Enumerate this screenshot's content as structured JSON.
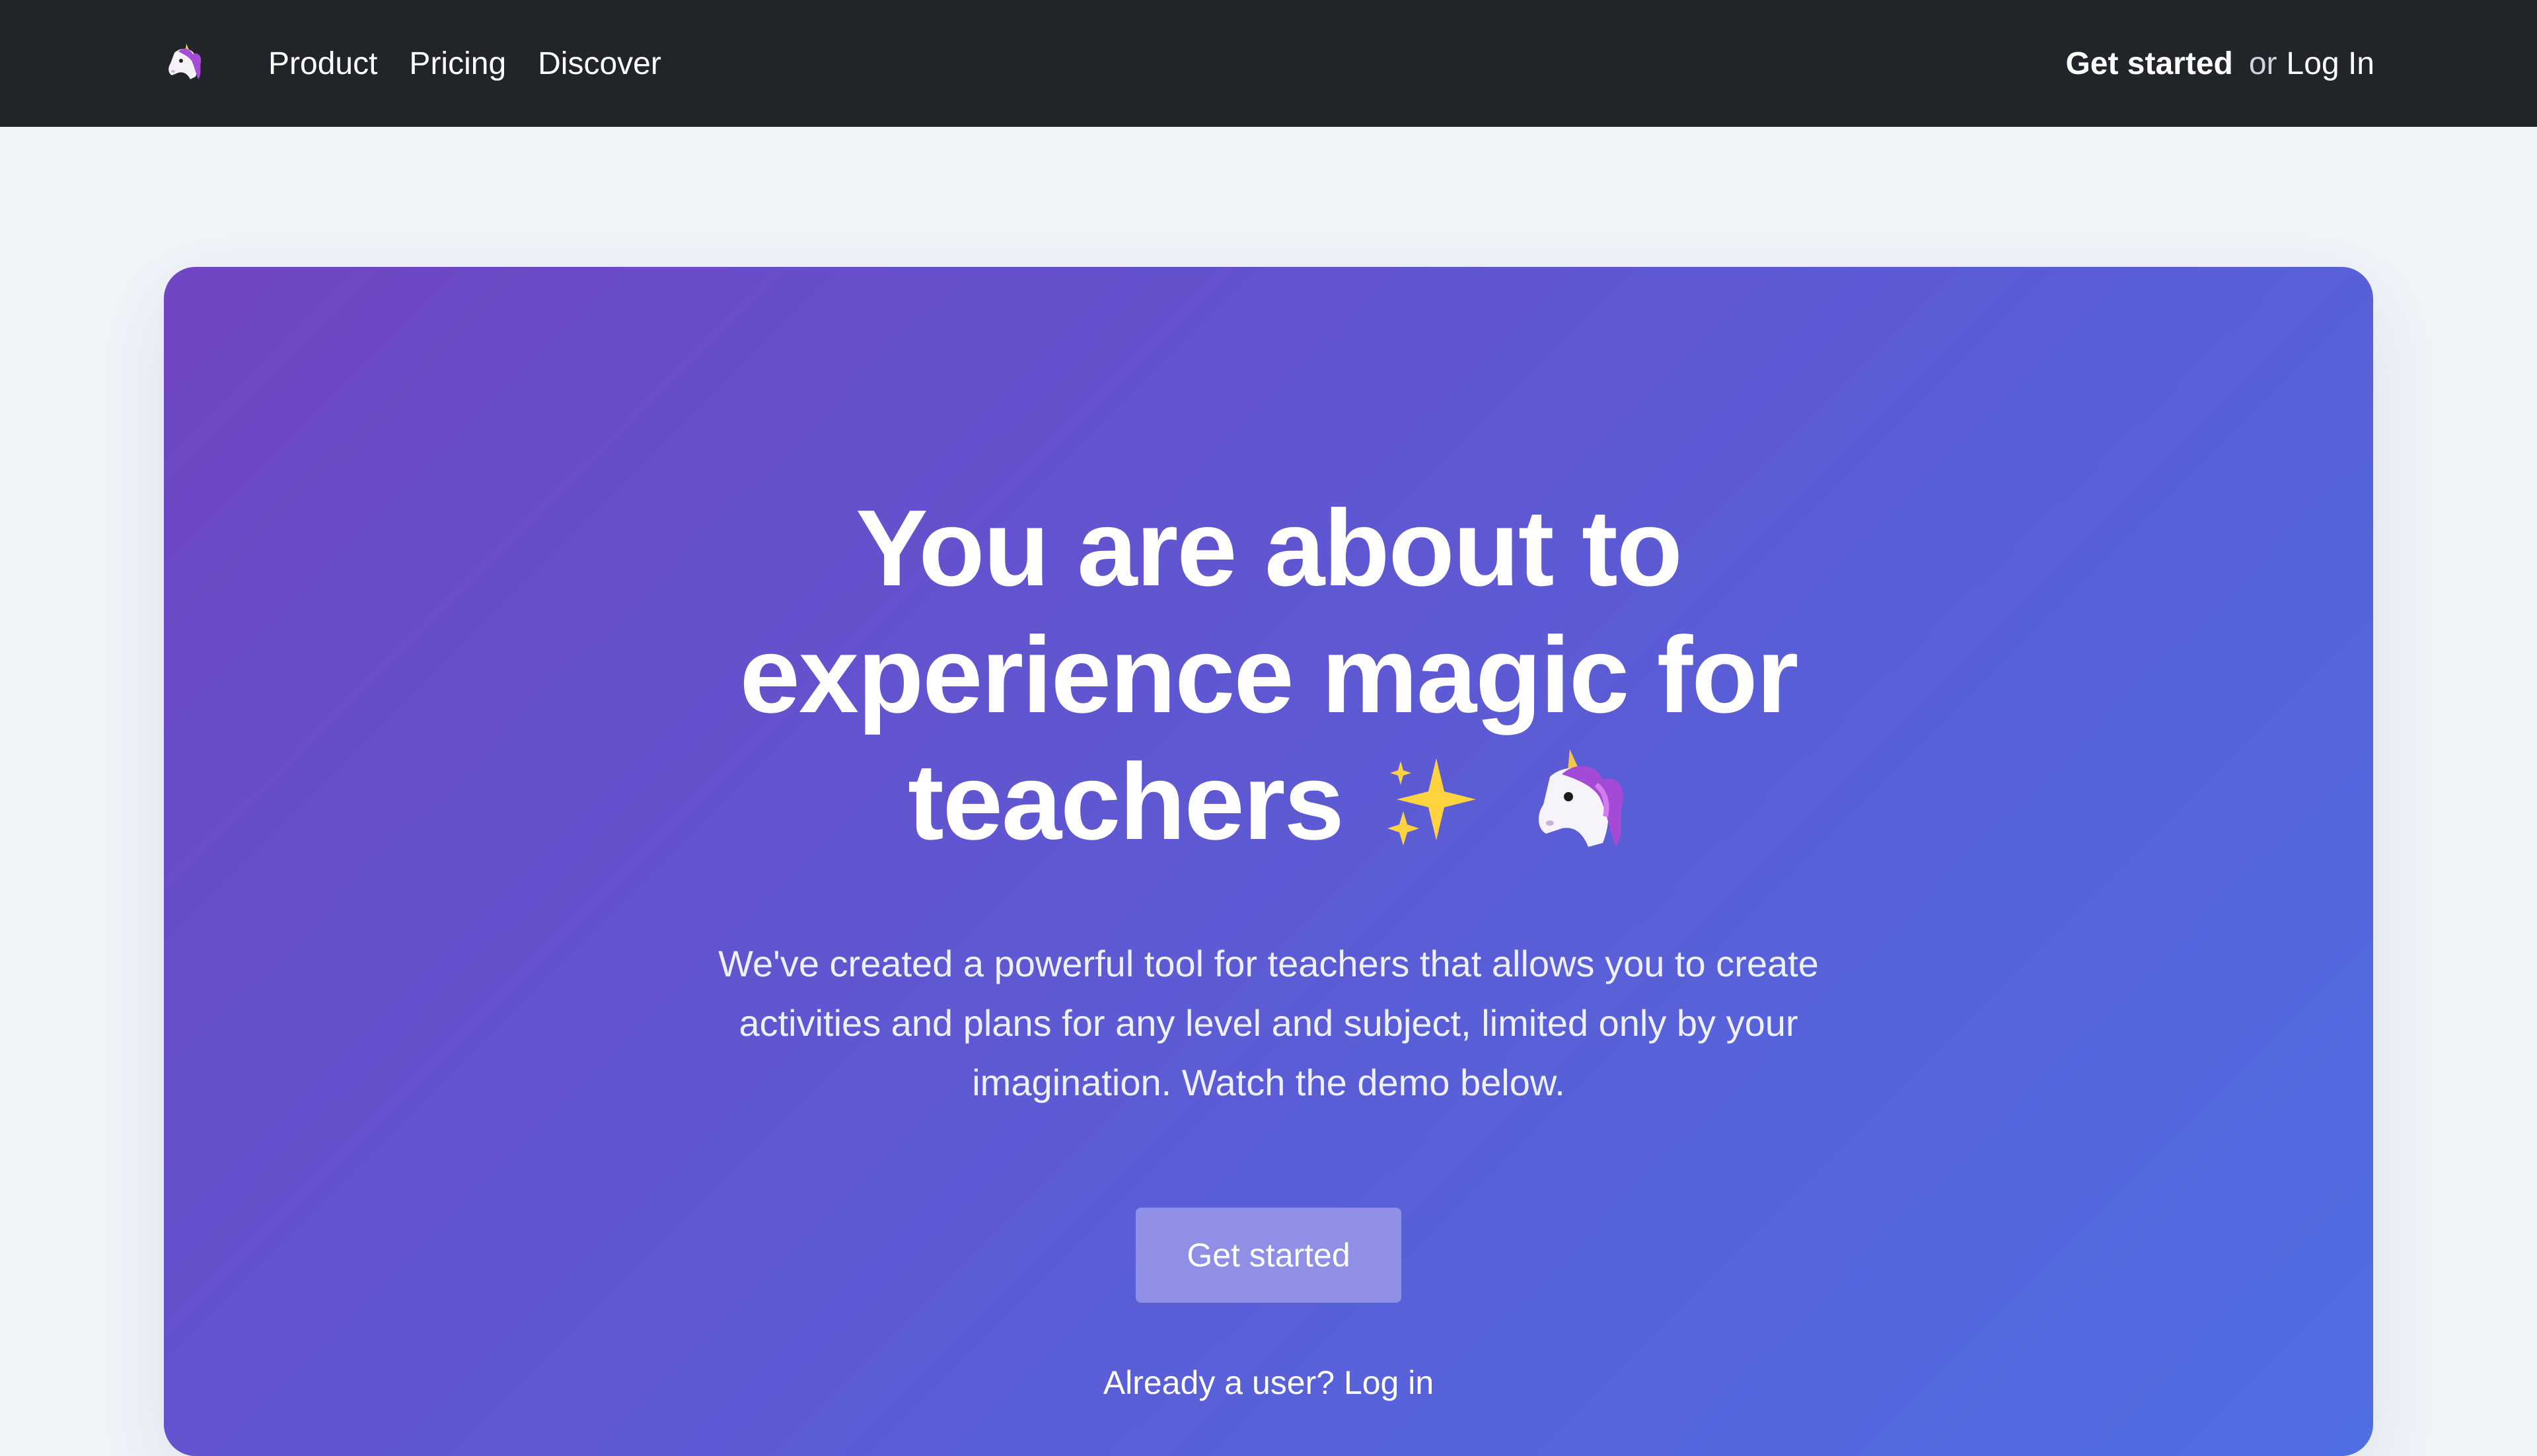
{
  "nav": {
    "logo_icon": "unicorn-icon",
    "items": [
      {
        "label": "Product"
      },
      {
        "label": "Pricing"
      },
      {
        "label": "Discover"
      }
    ],
    "get_started": "Get started",
    "or_text": "or",
    "log_in": "Log In"
  },
  "hero": {
    "headline_line1": "You are about to",
    "headline_line2": "experience magic for",
    "headline_line3": "teachers",
    "headline_icons": [
      "sparkles-icon",
      "unicorn-icon"
    ],
    "subtext": "We've created a powerful tool for teachers that allows you to create activities and plans for any level and subject, limited only by your imagination. Watch the demo below.",
    "cta_label": "Get started",
    "already_text": "Already a user?",
    "login_link": "Log in"
  },
  "colors": {
    "topbar": "#212429",
    "page_bg": "#f1f5fa",
    "gradient_start": "#7045c3",
    "gradient_end": "#4f6fe3",
    "cta_bg": "#8f8fe6"
  }
}
